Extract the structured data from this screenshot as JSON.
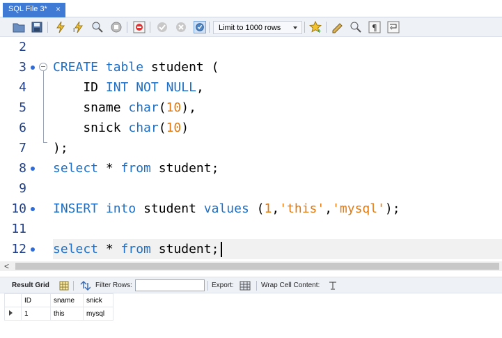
{
  "tab": {
    "title": "SQL File 3*",
    "close": "×"
  },
  "toolbar": {
    "limit_label": "Limit to 1000 rows",
    "icons": [
      "open-folder-icon",
      "save-icon",
      "execute-icon",
      "execute-current-icon",
      "explain-icon",
      "stop-icon",
      "toggle-error-icon",
      "commit-icon",
      "rollback-icon",
      "autocommit-icon",
      "bookmark-star-icon",
      "beautify-icon",
      "find-icon",
      "invisible-chars-icon",
      "wrap-icon"
    ]
  },
  "editor": {
    "lines": [
      {
        "n": "2",
        "dot": false
      },
      {
        "n": "3",
        "dot": true
      },
      {
        "n": "4",
        "dot": false
      },
      {
        "n": "5",
        "dot": false
      },
      {
        "n": "6",
        "dot": false
      },
      {
        "n": "7",
        "dot": false
      },
      {
        "n": "8",
        "dot": true
      },
      {
        "n": "9",
        "dot": false
      },
      {
        "n": "10",
        "dot": true
      },
      {
        "n": "11",
        "dot": false
      },
      {
        "n": "12",
        "dot": true
      }
    ],
    "code": {
      "l3": {
        "kw1": "CREATE",
        "kw2": "table",
        "rest": " student ("
      },
      "l4": {
        "pre": "    ID ",
        "kw1": "INT",
        "kw2": "NOT",
        "kw3": "NULL",
        "post": ","
      },
      "l5": {
        "pre": "    sname ",
        "kw": "char",
        "open": "(",
        "num": "10",
        "close": "),"
      },
      "l6": {
        "pre": "    snick ",
        "kw": "char",
        "open": "(",
        "num": "10",
        "close": ")"
      },
      "l7": {
        "text": ");"
      },
      "l8": {
        "kw1": "select",
        "mid": " * ",
        "kw2": "from",
        "rest": " student;"
      },
      "l10": {
        "kw1": "INSERT",
        "kw2": "into",
        "mid": " student ",
        "kw3": "values",
        "open": " (",
        "num": "1",
        "c1": ",",
        "s1": "'this'",
        "c2": ",",
        "s2": "'mysql'",
        "close": ");"
      },
      "l12": {
        "kw1": "select",
        "mid": " * ",
        "kw2": "from",
        "rest": " student;"
      }
    }
  },
  "scroll": {
    "left_arrow": "<"
  },
  "result_toolbar": {
    "result_grid": "Result Grid",
    "filter_rows": "Filter Rows:",
    "filter_value": "",
    "export": "Export:",
    "wrap_cell": "Wrap Cell Content:"
  },
  "result": {
    "columns": [
      "ID",
      "sname",
      "snick"
    ],
    "rows": [
      [
        "1",
        "this",
        "mysql"
      ]
    ]
  },
  "colors": {
    "accent": "#3f7bd5",
    "keyword": "#1d6fc7",
    "literal": "#e07a12",
    "line_number": "#1f3f8a"
  }
}
